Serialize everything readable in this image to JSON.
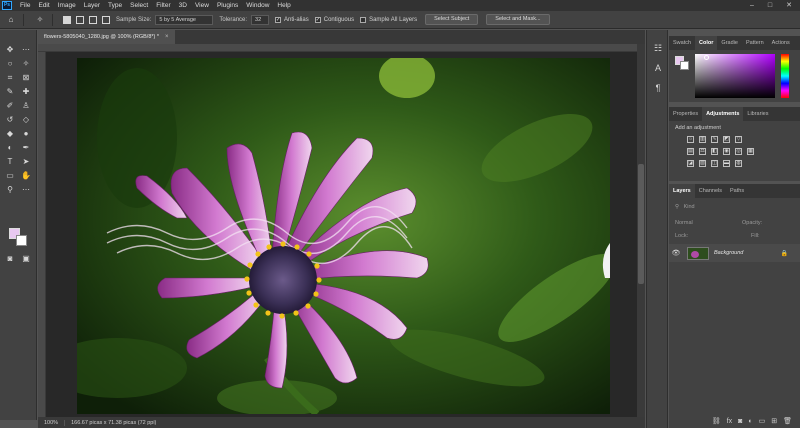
{
  "app": {
    "logo_text": "Ps"
  },
  "menubar": {
    "items": [
      "File",
      "Edit",
      "Image",
      "Layer",
      "Type",
      "Select",
      "Filter",
      "3D",
      "View",
      "Plugins",
      "Window",
      "Help"
    ],
    "minimize": "–",
    "maximize": "□",
    "close": "✕"
  },
  "options": {
    "sample_size_label": "Sample Size:",
    "sample_size_value": "5 by 5 Average",
    "tolerance_label": "Tolerance:",
    "tolerance_value": "32",
    "anti_alias_label": "Anti-alias",
    "anti_alias_checked": true,
    "contiguous_label": "Contiguous",
    "contiguous_checked": true,
    "sample_all_layers_label": "Sample All Layers",
    "sample_all_layers_checked": false,
    "select_subject_label": "Select Subject",
    "select_and_mask_label": "Select and Mask..."
  },
  "document": {
    "tab_title": "flowers-5805040_1280.jpg @ 100% (RGB/8*) *",
    "tab_close": "×"
  },
  "statusbar": {
    "zoom": "100%",
    "info": "166.67 picas x 71.38 picas (72 ppi)"
  },
  "color_panel": {
    "tabs": [
      "Swatch",
      "Color",
      "Gradie",
      "Pattern",
      "Actions"
    ],
    "active_tab": "Color",
    "colors": {
      "foreground": "#e8c8f0",
      "background": "#ffffff",
      "hue": "#b100ff"
    }
  },
  "adjustments_panel": {
    "tabs": [
      "Properties",
      "Adjustments",
      "Libraries"
    ],
    "active_tab": "Adjustments",
    "title": "Add an adjustment"
  },
  "layers_panel": {
    "tabs": [
      "Layers",
      "Channels",
      "Paths"
    ],
    "active_tab": "Layers",
    "filter_placeholder": "Kind",
    "blend_mode": "Normal",
    "opacity_label": "Opacity:",
    "lock_label": "Lock:",
    "fill_label": "Fill:",
    "layers": [
      {
        "name": "Background",
        "visible": true,
        "locked": true
      }
    ]
  },
  "colors": {
    "chrome_dark": "#323232",
    "panel": "#424242",
    "canvas_bg": "#282828",
    "accent": "#31a8ff"
  }
}
